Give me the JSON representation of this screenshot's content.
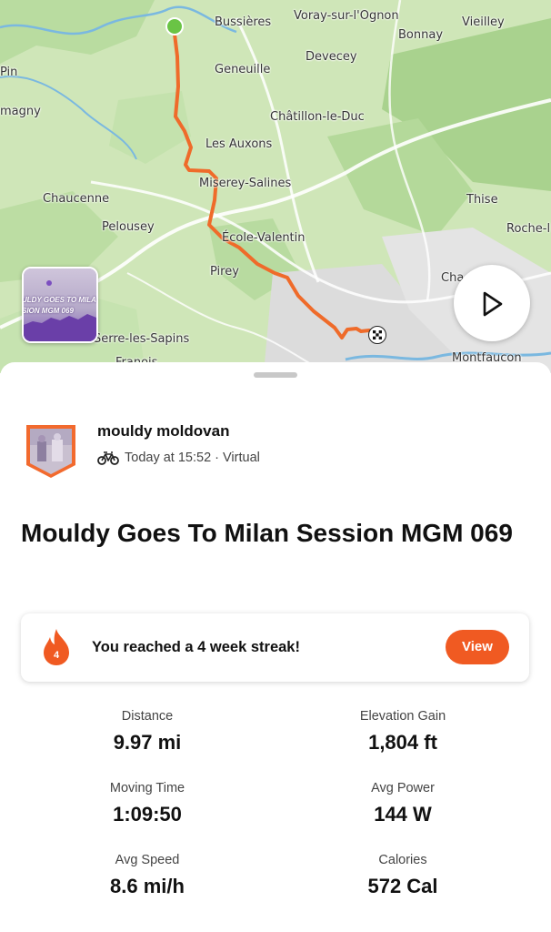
{
  "map": {
    "places": [
      "Bussières",
      "Voray-sur-l'Ognon",
      "Vieilley",
      "Bonnay",
      "Devecey",
      "Pin",
      "Geneuille",
      "magny",
      "Châtillon-le-Duc",
      "Les Auxons",
      "Miserey-Salines",
      "Chaucenne",
      "Thise",
      "Pelousey",
      "École-Valentin",
      "Roche-l",
      "Pirey",
      "Cha",
      "Serre-les-Sapins",
      "Franois",
      "Montfaucon"
    ],
    "route_color": "#ef6b2a",
    "start_marker_color": "#6ac445",
    "thumbnail_text_1": "ULDY GOES TO MILAN",
    "thumbnail_text_2": "SION MGM 069",
    "play_icon": "play-icon"
  },
  "athlete": {
    "name": "mouldy moldovan",
    "activity_icon": "bike-icon",
    "meta": "Today at 15:52 · Virtual"
  },
  "activity": {
    "title": "Mouldy Goes To Milan Session MGM 069"
  },
  "streak": {
    "icon": "flame-icon",
    "weeks": "4",
    "message": "You reached a 4 week streak!",
    "button_label": "View",
    "accent": "#f05a22"
  },
  "stats": [
    {
      "label": "Distance",
      "value": "9.97 mi"
    },
    {
      "label": "Elevation Gain",
      "value": "1,804 ft"
    },
    {
      "label": "Moving Time",
      "value": "1:09:50"
    },
    {
      "label": "Avg Power",
      "value": "144 W"
    },
    {
      "label": "Avg Speed",
      "value": "8.6 mi/h"
    },
    {
      "label": "Calories",
      "value": "572 Cal"
    }
  ]
}
